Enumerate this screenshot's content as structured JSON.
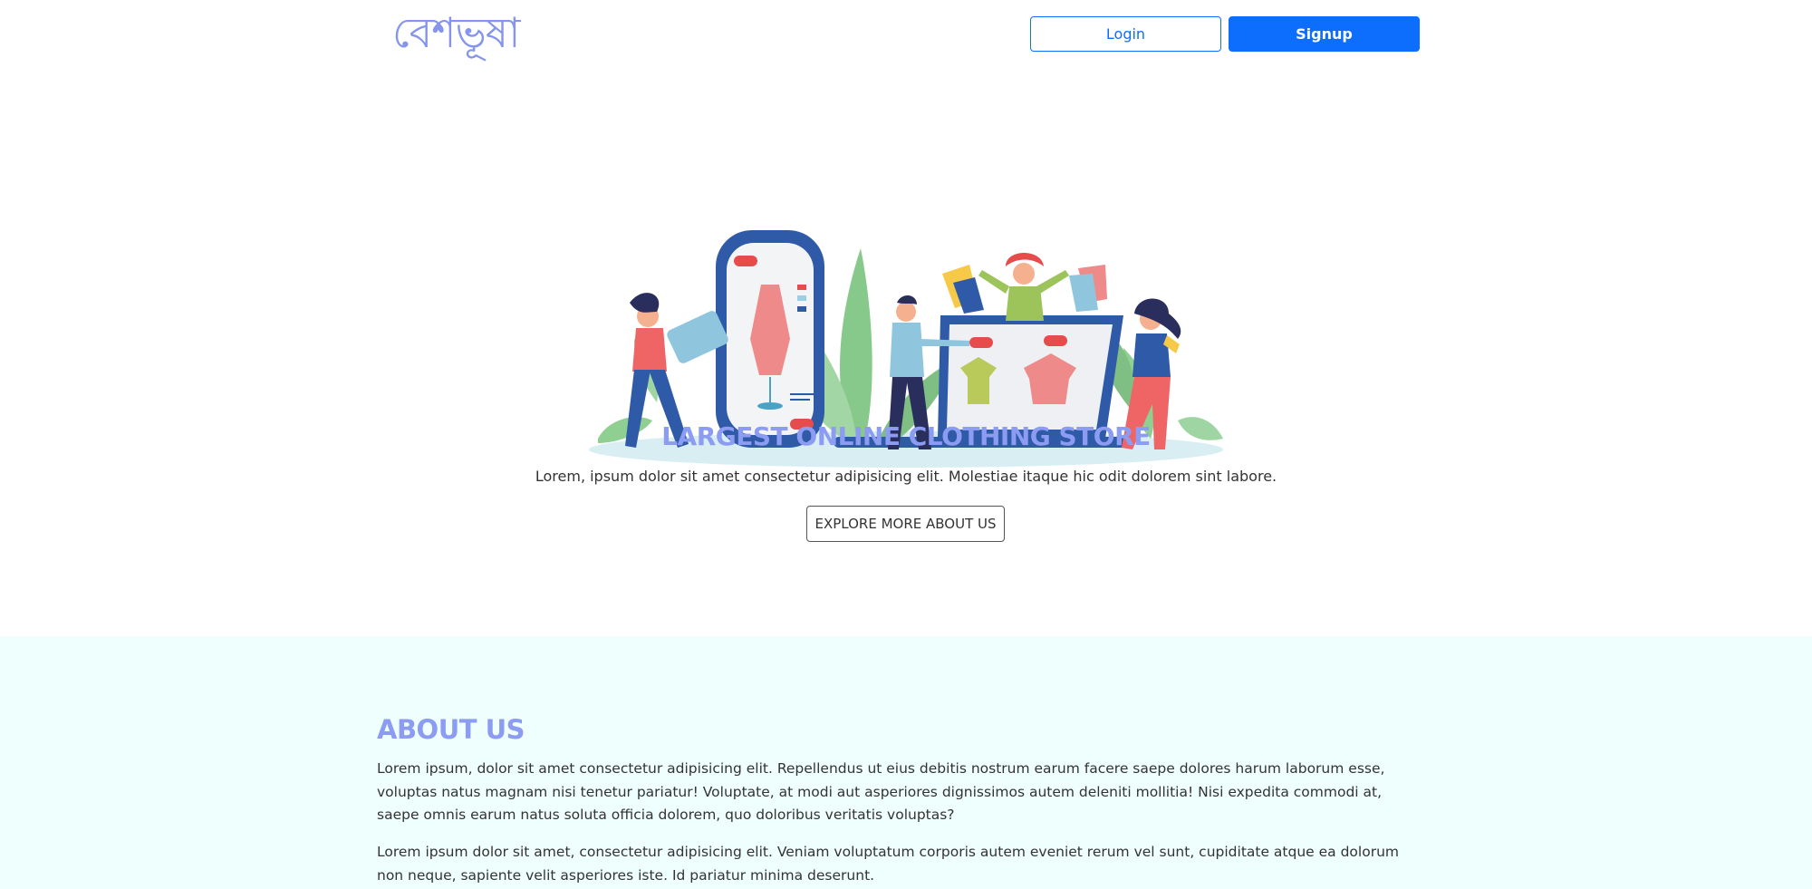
{
  "header": {
    "logo": "বেশভূষা",
    "login_label": "Login",
    "signup_label": "Signup"
  },
  "hero": {
    "illustration": "online-shopping-illustration",
    "title": "LARGEST ONLINE CLOTHING STORE",
    "text": "Lorem, ipsum dolor sit amet consectetur adipisicing elit. Molestiae itaque hic odit dolorem sint labore.",
    "button_label": "EXPLORE MORE ABOUT US"
  },
  "about": {
    "title": "ABOUT US",
    "paragraphs": [
      "Lorem ipsum, dolor sit amet consectetur adipisicing elit. Repellendus ut eius debitis nostrum earum facere saepe dolores harum laborum esse, voluptas natus magnam nisi tenetur pariatur! Voluptate, at modi aut asperiores dignissimos autem deleniti mollitia! Nisi expedita commodi at, saepe omnis earum natus soluta officia dolorem, quo doloribus veritatis voluptas?",
      "Lorem ipsum dolor sit amet, consectetur adipisicing elit. Veniam voluptatum corporis autem eveniet rerum vel sunt, cupiditate atque ea dolorum non neque, sapiente velit asperiores iste. Id pariatur minima deserunt."
    ]
  },
  "colors": {
    "accent": "#8c9cf2",
    "primary_button": "#0d6efd",
    "about_background": "#effffe"
  }
}
